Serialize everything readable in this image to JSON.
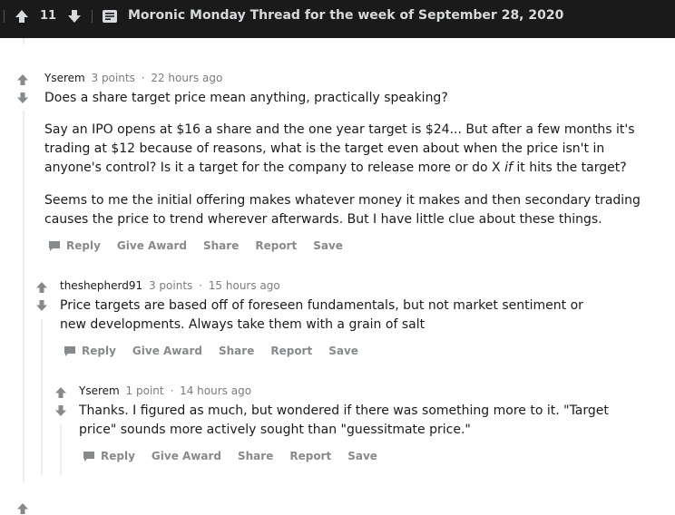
{
  "post": {
    "score": "11",
    "title": "Moronic Monday Thread for the week of September 28, 2020"
  },
  "actions": {
    "reply": "Reply",
    "give_award": "Give Award",
    "share": "Share",
    "report": "Report",
    "save": "Save"
  },
  "comments": [
    {
      "author": "Yserem",
      "points": "3 points",
      "age": "22 hours ago",
      "paragraphs": [
        "Does a share target price mean anything, practically speaking?",
        "Say an IPO opens at $16 a share and the one year target is $24... But after a few months it's trading at $12 because of reasons, what is the target even about when the price isn't in anyone's control? Is it a target for the company to release more or do X",
        "if",
        "it hits the target?",
        "Seems to me the initial offering makes whatever money it makes and then secondary trading causes the price to trend wherever afterwards. But I have little clue about these things."
      ]
    },
    {
      "author": "theshepherd91",
      "points": "3 points",
      "age": "15 hours ago",
      "paragraphs": [
        "Price targets are based off of foreseen fundamentals, but not market sentiment or new developments. Always take them with a grain of salt"
      ]
    },
    {
      "author": "Yserem",
      "points": "1 point",
      "age": "14 hours ago",
      "paragraphs": [
        "Thanks. I figured as much, but wondered if there was something more to it. \"Target price\" sounds more actively sought than \"guessitmate price.\""
      ]
    }
  ]
}
